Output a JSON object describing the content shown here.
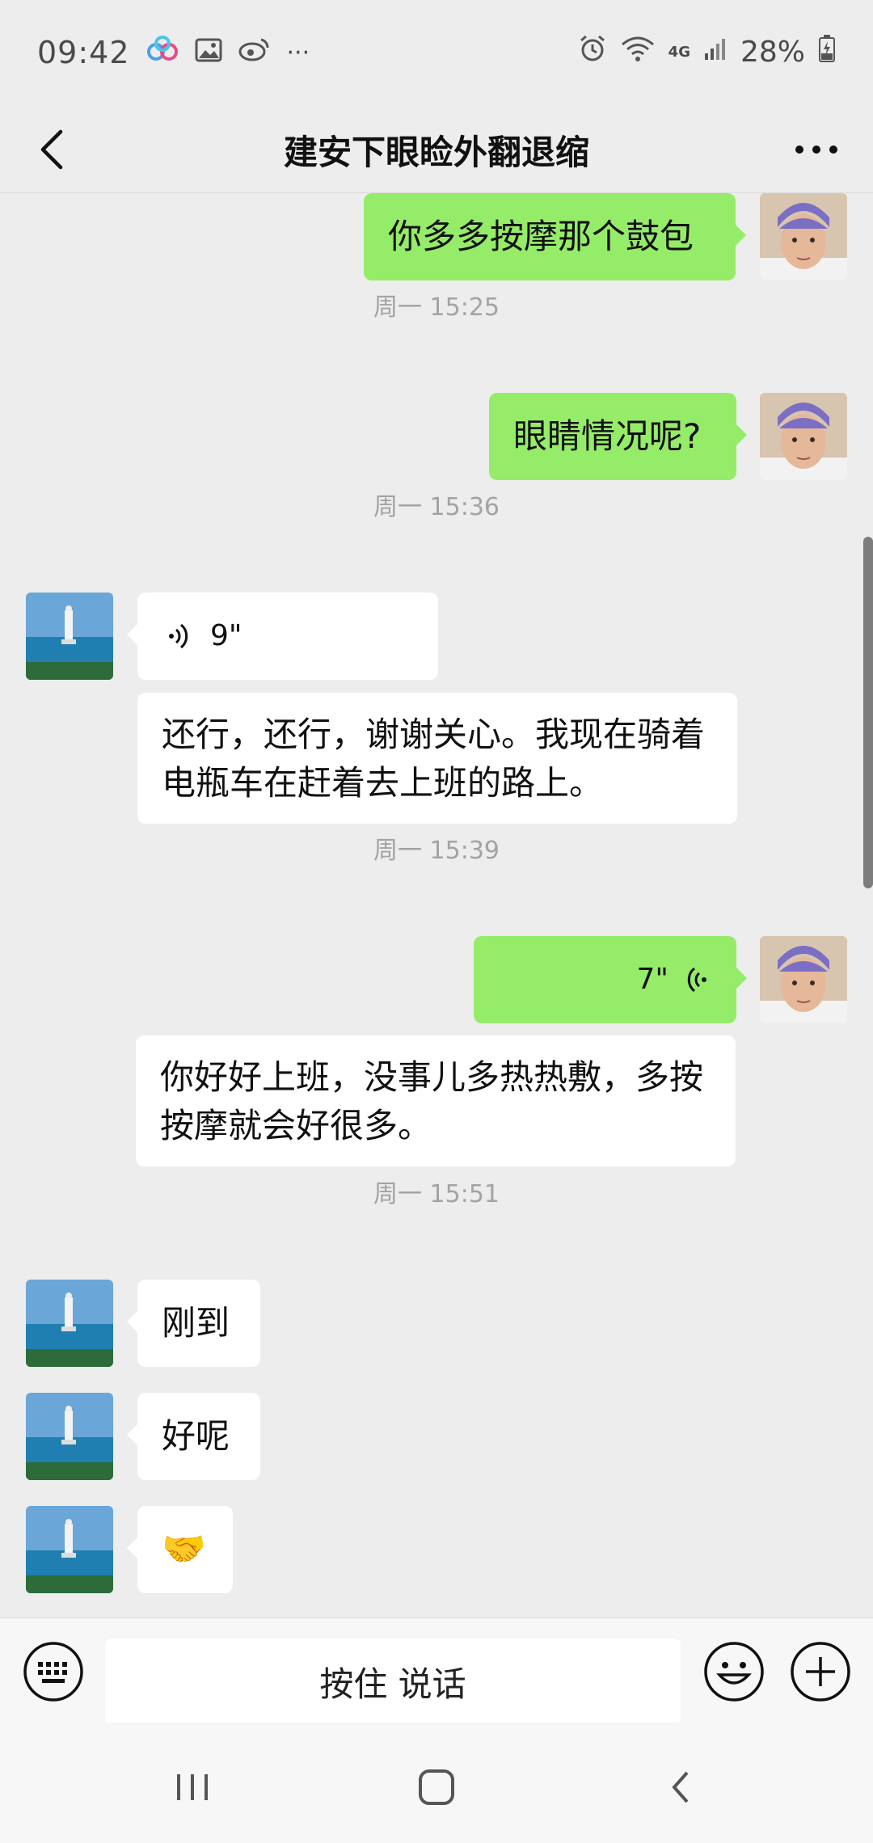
{
  "status_bar": {
    "time": "09:42",
    "battery": "28%",
    "network": "4G",
    "more": "···"
  },
  "header": {
    "title": "建安下眼睑外翻退缩"
  },
  "messages": [
    {
      "type": "text",
      "side": "right",
      "text": "你多多按摩那个鼓包"
    },
    {
      "type": "timestamp",
      "text": "周一 15:25"
    },
    {
      "type": "text",
      "side": "right",
      "text": "眼睛情况呢?"
    },
    {
      "type": "timestamp",
      "text": "周一 15:36"
    },
    {
      "type": "voice",
      "side": "left",
      "duration": "9\""
    },
    {
      "type": "text",
      "side": "left",
      "lines": [
        "还行，还行，谢谢关心。我现在骑着",
        "电瓶车在赶着去上班的路上。"
      ]
    },
    {
      "type": "timestamp",
      "text": "周一 15:39"
    },
    {
      "type": "voice",
      "side": "right",
      "duration": "7\""
    },
    {
      "type": "text",
      "side": "left",
      "lines": [
        "你好好上班，没事儿多热热敷，多按",
        "按摩就会好很多。"
      ]
    },
    {
      "type": "timestamp",
      "text": "周一 15:51"
    },
    {
      "type": "text",
      "side": "left",
      "text": "刚到"
    },
    {
      "type": "text",
      "side": "left",
      "text": "好呢"
    },
    {
      "type": "emoji",
      "side": "left",
      "text": "🤝"
    }
  ],
  "input_bar": {
    "talk_label": "按住 说话"
  },
  "colors": {
    "sent_bubble": "#95ec69",
    "received_bubble": "#ffffff",
    "background": "#ededed"
  }
}
